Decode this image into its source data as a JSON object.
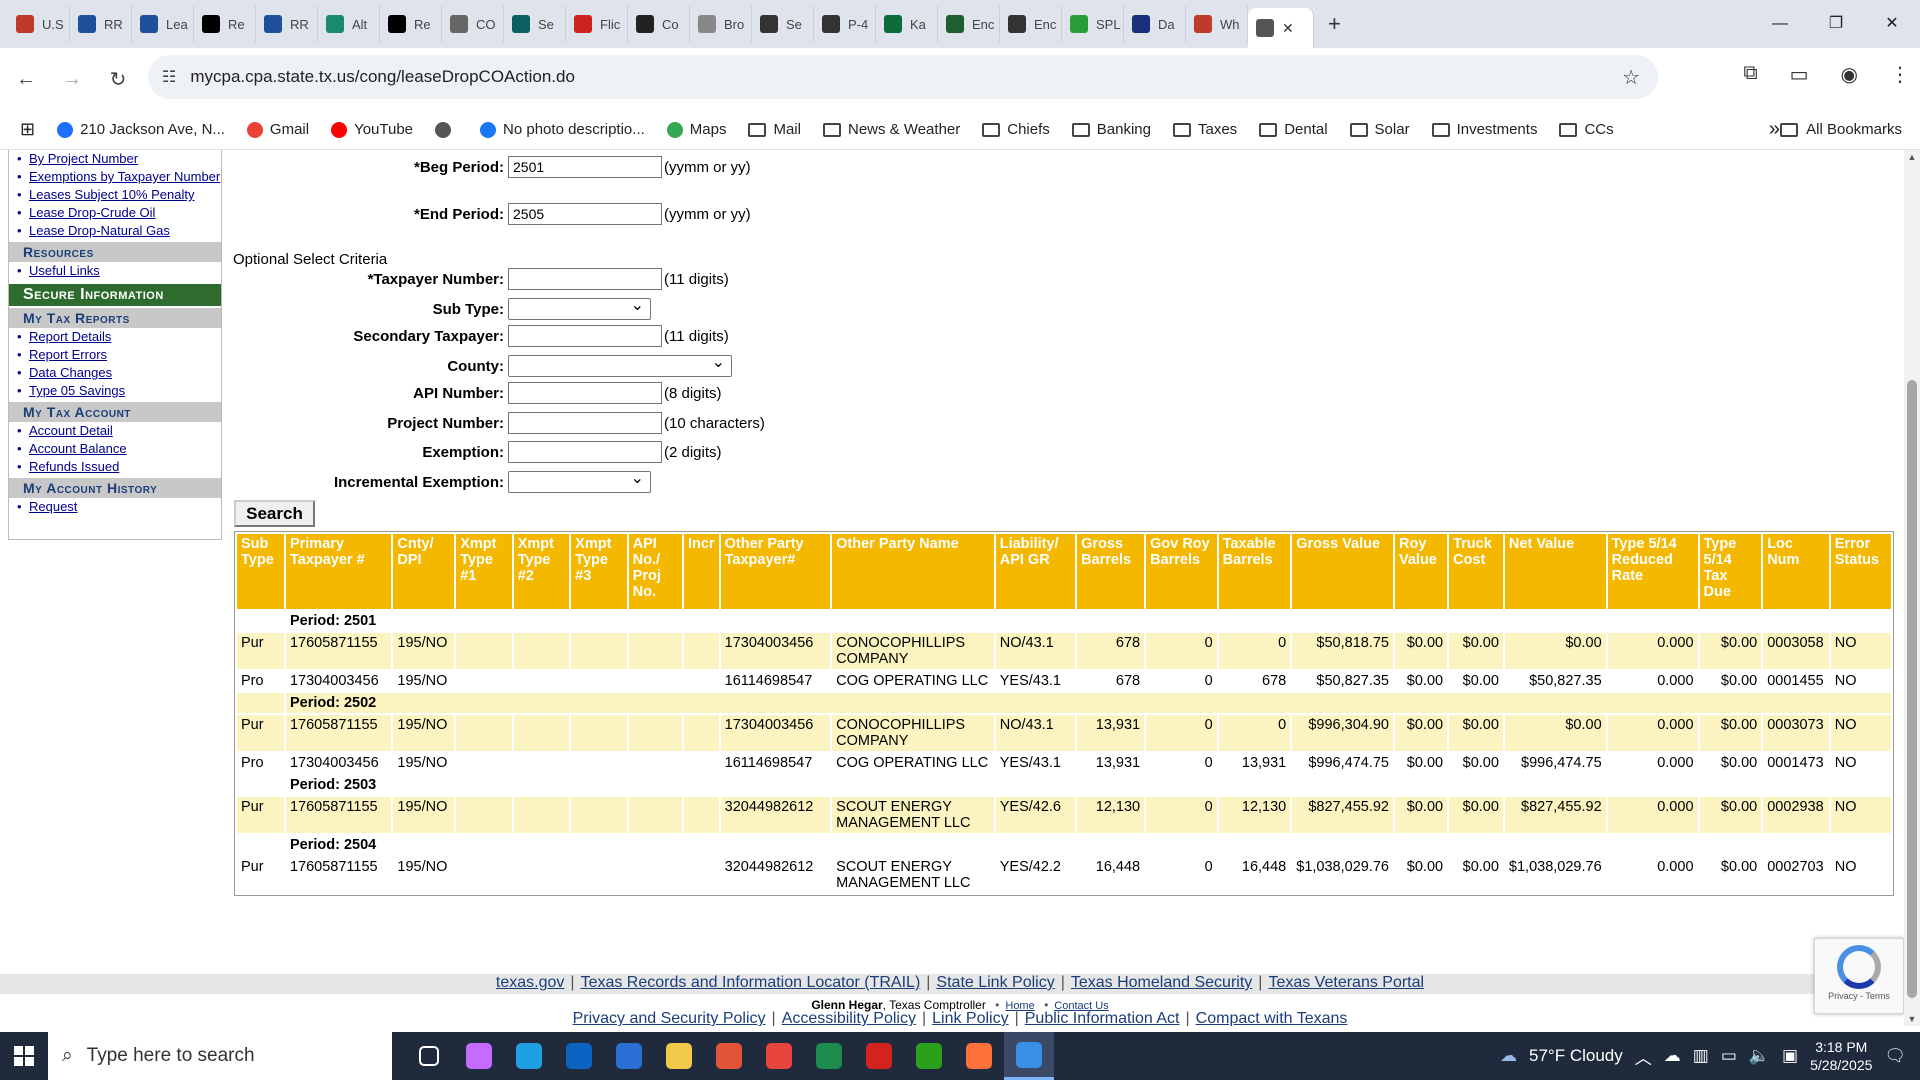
{
  "browser": {
    "tabs": [
      {
        "label": "U.S",
        "color": "#c0392b"
      },
      {
        "label": "RR",
        "color": "#1f4f9b"
      },
      {
        "label": "Lea",
        "color": "#1f4f9b"
      },
      {
        "label": "Re",
        "color": "#000000"
      },
      {
        "label": "RR",
        "color": "#1f4f9b"
      },
      {
        "label": "Alt",
        "color": "#1b8a6b"
      },
      {
        "label": "Re",
        "color": "#000000"
      },
      {
        "label": "CO",
        "color": "#666666"
      },
      {
        "label": "Se",
        "color": "#0a5f5f"
      },
      {
        "label": "Flic",
        "color": "#cc2222"
      },
      {
        "label": "Co",
        "color": "#222222"
      },
      {
        "label": "Bro",
        "color": "#888888"
      },
      {
        "label": "Se",
        "color": "#333333"
      },
      {
        "label": "P-4",
        "color": "#333333"
      },
      {
        "label": "Ka",
        "color": "#0b6b3a"
      },
      {
        "label": "Enc",
        "color": "#1f5e2e"
      },
      {
        "label": "Enc",
        "color": "#333333"
      },
      {
        "label": "SPL",
        "color": "#2a9d3a"
      },
      {
        "label": "Da",
        "color": "#1a2f7a"
      },
      {
        "label": "Wh",
        "color": "#c0392b"
      }
    ],
    "active_tab_label": "",
    "url": "mycpa.cpa.state.tx.us/cong/leaseDropCOAction.do",
    "bookmarks": [
      {
        "label": "210 Jackson Ave, N...",
        "icon": "zillow-icon"
      },
      {
        "label": "Gmail",
        "icon": "google-icon"
      },
      {
        "label": "YouTube",
        "icon": "youtube-icon"
      },
      {
        "label": "",
        "icon": "globe-icon"
      },
      {
        "label": "No photo descriptio...",
        "icon": "facebook-icon"
      },
      {
        "label": "Maps",
        "icon": "maps-icon"
      },
      {
        "label": "Mail",
        "icon": "folder-icon"
      },
      {
        "label": "News & Weather",
        "icon": "folder-icon"
      },
      {
        "label": "Chiefs",
        "icon": "folder-icon"
      },
      {
        "label": "Banking",
        "icon": "folder-icon"
      },
      {
        "label": "Taxes",
        "icon": "folder-icon"
      },
      {
        "label": "Dental",
        "icon": "folder-icon"
      },
      {
        "label": "Solar",
        "icon": "folder-icon"
      },
      {
        "label": "Investments",
        "icon": "folder-icon"
      },
      {
        "label": "CCs",
        "icon": "folder-icon"
      }
    ],
    "all_bookmarks": "All Bookmarks"
  },
  "sidebar": {
    "top_links": [
      "By Project Number",
      "Exemptions by Taxpayer Number",
      "Leases Subject 10% Penalty",
      "Lease Drop-Crude Oil",
      "Lease Drop-Natural Gas"
    ],
    "resources_head": "Resources",
    "resources_links": [
      "Useful Links"
    ],
    "secure_head": "Secure Information",
    "reports_head": "My Tax Reports",
    "reports_links": [
      "Report Details",
      "Report Errors",
      "Data Changes",
      "Type 05 Savings"
    ],
    "account_head": "My Tax Account",
    "account_links": [
      "Account Detail",
      "Account Balance",
      "Refunds Issued"
    ],
    "history_head": "My Account History",
    "history_links": [
      "Request"
    ]
  },
  "form": {
    "beg_label": "*Beg Period:",
    "beg_value": "2501",
    "beg_hint": "(yymm or yy)",
    "end_label": "*End Period:",
    "end_value": "2505",
    "end_hint": "(yymm or yy)",
    "optional": "Optional Select Criteria",
    "taxpayer_label": "*Taxpayer Number:",
    "taxpayer_hint": "(11 digits)",
    "subtype_label": "Sub Type:",
    "secondary_label": "Secondary Taxpayer:",
    "secondary_hint": "(11 digits)",
    "county_label": "County:",
    "api_label": "API Number:",
    "api_hint": "(8 digits)",
    "project_label": "Project Number:",
    "project_hint": "(10 characters)",
    "exemption_label": "Exemption:",
    "exemption_hint": "(2 digits)",
    "incremental_label": "Incremental Exemption:",
    "search_label": "Search"
  },
  "table": {
    "headers": [
      "Sub Type",
      "Primary Taxpayer #",
      "Cnty/ DPI",
      "Xmpt Type #1",
      "Xmpt Type #2",
      "Xmpt Type #3",
      "API No./ Proj No.",
      "Incr",
      "Other Party Taxpayer#",
      "Other Party Name",
      "Liability/ API GR",
      "Gross Barrels",
      "Gov Roy Barrels",
      "Taxable Barrels",
      "Gross Value",
      "Roy Value",
      "Truck Cost",
      "Net Value",
      "Type 5/14 Reduced Rate",
      "Type 5/14 Tax Due",
      "Loc Num",
      "Error Status"
    ],
    "rows": [
      {
        "type": "period",
        "label": "Period: 2501"
      },
      {
        "type": "data",
        "cells": [
          "Pur",
          "17605871155",
          "195/NO",
          "",
          "",
          "",
          "",
          "",
          "17304003456",
          "CONOCOPHILLIPS COMPANY",
          "NO/43.1",
          "678",
          "0",
          "0",
          "$50,818.75",
          "$0.00",
          "$0.00",
          "$0.00",
          "0.000",
          "$0.00",
          "0003058",
          "NO"
        ]
      },
      {
        "type": "data",
        "cells": [
          "Pro",
          "17304003456",
          "195/NO",
          "",
          "",
          "",
          "",
          "",
          "16114698547",
          "COG OPERATING LLC",
          "YES/43.1",
          "678",
          "0",
          "678",
          "$50,827.35",
          "$0.00",
          "$0.00",
          "$50,827.35",
          "0.000",
          "$0.00",
          "0001455",
          "NO"
        ]
      },
      {
        "type": "period",
        "label": "Period: 2502"
      },
      {
        "type": "data",
        "cells": [
          "Pur",
          "17605871155",
          "195/NO",
          "",
          "",
          "",
          "",
          "",
          "17304003456",
          "CONOCOPHILLIPS COMPANY",
          "NO/43.1",
          "13,931",
          "0",
          "0",
          "$996,304.90",
          "$0.00",
          "$0.00",
          "$0.00",
          "0.000",
          "$0.00",
          "0003073",
          "NO"
        ]
      },
      {
        "type": "data",
        "cells": [
          "Pro",
          "17304003456",
          "195/NO",
          "",
          "",
          "",
          "",
          "",
          "16114698547",
          "COG OPERATING LLC",
          "YES/43.1",
          "13,931",
          "0",
          "13,931",
          "$996,474.75",
          "$0.00",
          "$0.00",
          "$996,474.75",
          "0.000",
          "$0.00",
          "0001473",
          "NO"
        ]
      },
      {
        "type": "period",
        "label": "Period: 2503"
      },
      {
        "type": "data",
        "cells": [
          "Pur",
          "17605871155",
          "195/NO",
          "",
          "",
          "",
          "",
          "",
          "32044982612",
          "SCOUT ENERGY MANAGEMENT LLC",
          "YES/42.6",
          "12,130",
          "0",
          "12,130",
          "$827,455.92",
          "$0.00",
          "$0.00",
          "$827,455.92",
          "0.000",
          "$0.00",
          "0002938",
          "NO"
        ]
      },
      {
        "type": "period",
        "label": "Period: 2504"
      },
      {
        "type": "data",
        "cells": [
          "Pur",
          "17605871155",
          "195/NO",
          "",
          "",
          "",
          "",
          "",
          "32044982612",
          "SCOUT ENERGY MANAGEMENT LLC",
          "YES/42.2",
          "16,448",
          "0",
          "16,448",
          "$1,038,029.76",
          "$0.00",
          "$0.00",
          "$1,038,029.76",
          "0.000",
          "$0.00",
          "0002703",
          "NO"
        ]
      }
    ]
  },
  "footer": {
    "links1": [
      "texas.gov",
      "Texas Records and Information Locator (TRAIL)",
      "State Link Policy",
      "Texas Homeland Security",
      "Texas Veterans Portal"
    ],
    "name_bold": "Glenn Hegar",
    "name_rest": ", Texas Comptroller",
    "home": "Home",
    "contact": "Contact Us",
    "links2": [
      "Privacy and Security Policy",
      "Accessibility Policy",
      "Link Policy",
      "Public Information Act",
      "Compact with Texans"
    ]
  },
  "recaptcha": {
    "text": "Privacy - Terms"
  },
  "taskbar": {
    "search_placeholder": "Type here to search",
    "weather": "57°F  Cloudy",
    "time": "3:18 PM",
    "date": "5/28/2025",
    "icons": [
      {
        "name": "task-view-icon",
        "color": "#ffffff"
      },
      {
        "name": "copilot-icon",
        "color": "#c56bff"
      },
      {
        "name": "edge-icon",
        "color": "#1fa0e3"
      },
      {
        "name": "outlook-icon",
        "color": "#0a64c2"
      },
      {
        "name": "store-icon",
        "color": "#2b6fd6"
      },
      {
        "name": "file-explorer-icon",
        "color": "#f2c94c"
      },
      {
        "name": "m365-icon",
        "color": "#e0553a"
      },
      {
        "name": "chrome-icon",
        "color": "#e8453c"
      },
      {
        "name": "excel-icon",
        "color": "#1e8a4c"
      },
      {
        "name": "acrobat-icon",
        "color": "#d4221e"
      },
      {
        "name": "quickbooks-icon",
        "color": "#2ca01c"
      },
      {
        "name": "firefox-icon",
        "color": "#ff7139"
      },
      {
        "name": "photos-icon",
        "color": "#3a8ee6"
      }
    ]
  }
}
